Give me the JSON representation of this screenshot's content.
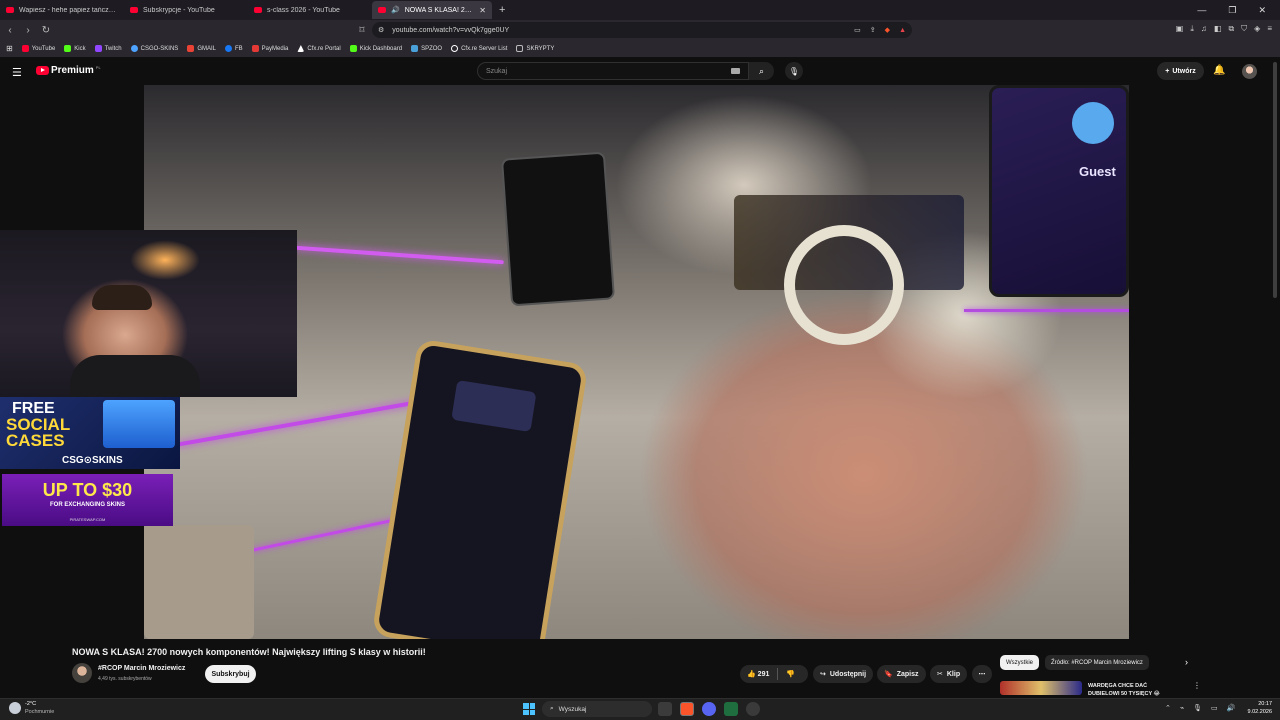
{
  "browser": {
    "tabs": [
      {
        "label": "Wapiesz - hehe papież tańczy - YouT",
        "active": false
      },
      {
        "label": "Subskrypcje - YouTube",
        "active": false
      },
      {
        "label": "s-class 2026 - YouTube",
        "active": false
      },
      {
        "label": "NOWA S KLASA! 2700 nowych",
        "active": true
      }
    ],
    "url": "youtube.com/watch?v=vvQk7gge0UY",
    "bookmarks": [
      {
        "label": "YouTube",
        "color": "#ff0033"
      },
      {
        "label": "Kick",
        "color": "#53fc18"
      },
      {
        "label": "Twitch",
        "color": "#9146ff"
      },
      {
        "label": "CSGO-SKINS",
        "color": "#4da3ff"
      },
      {
        "label": "GMAIL",
        "color": "#ea4335"
      },
      {
        "label": "FB",
        "color": "#1877f2"
      },
      {
        "label": "PayMedia",
        "color": "#e53935"
      },
      {
        "label": "Cfx.re Portal",
        "color": "#ffffff"
      },
      {
        "label": "Kick Dashboard",
        "color": "#53fc18"
      },
      {
        "label": "SPZOO",
        "color": "#4aa0d8"
      },
      {
        "label": "Cfx.re Server List",
        "color": "#ffffff"
      },
      {
        "label": "SKRYPTY",
        "color": "#bbbbbb"
      }
    ]
  },
  "youtube": {
    "logo_text": "Premium",
    "logo_region": "PL",
    "search_placeholder": "Szukaj",
    "create_label": "Utwórz"
  },
  "video": {
    "guest_label": "Guest",
    "title": "NOWA S KLASA! 2700 nowych komponentów! Największy lifting S klasy w historii!",
    "channel_name": "#RCOP Marcin Mroziewicz",
    "subscribers": "4,49 tys. subskrybentów",
    "subscribe_label": "Subskrybuj",
    "like_count": "291",
    "share_label": "Udostępnij",
    "save_label": "Zapisz",
    "clip_label": "Klip"
  },
  "overlays": {
    "ad1_line1": "FREE",
    "ad1_line2": "SOCIAL",
    "ad1_line3": "CASES",
    "ad1_brand": "CSG⊙SKINS",
    "ad2_main": "UP TO $30",
    "ad2_sub": "FOR EXCHANGING SKINS",
    "ad2_brand": "PIRATESWAP.COM"
  },
  "sidebar": {
    "chips": [
      {
        "label": "Wszystkie",
        "selected": true
      },
      {
        "label": "Źródło: #RCOP Marcin Mroziewicz",
        "selected": false
      }
    ],
    "recommendation_title": "WARDĘGA CHCE DAĆ DUBIELOWI 50 TYSIĘCY 😂"
  },
  "taskbar": {
    "temperature": "-2°C",
    "weather": "Pochmurnie",
    "search_label": "Wyszukaj",
    "time": "20:17",
    "date": "9.02.2026"
  }
}
